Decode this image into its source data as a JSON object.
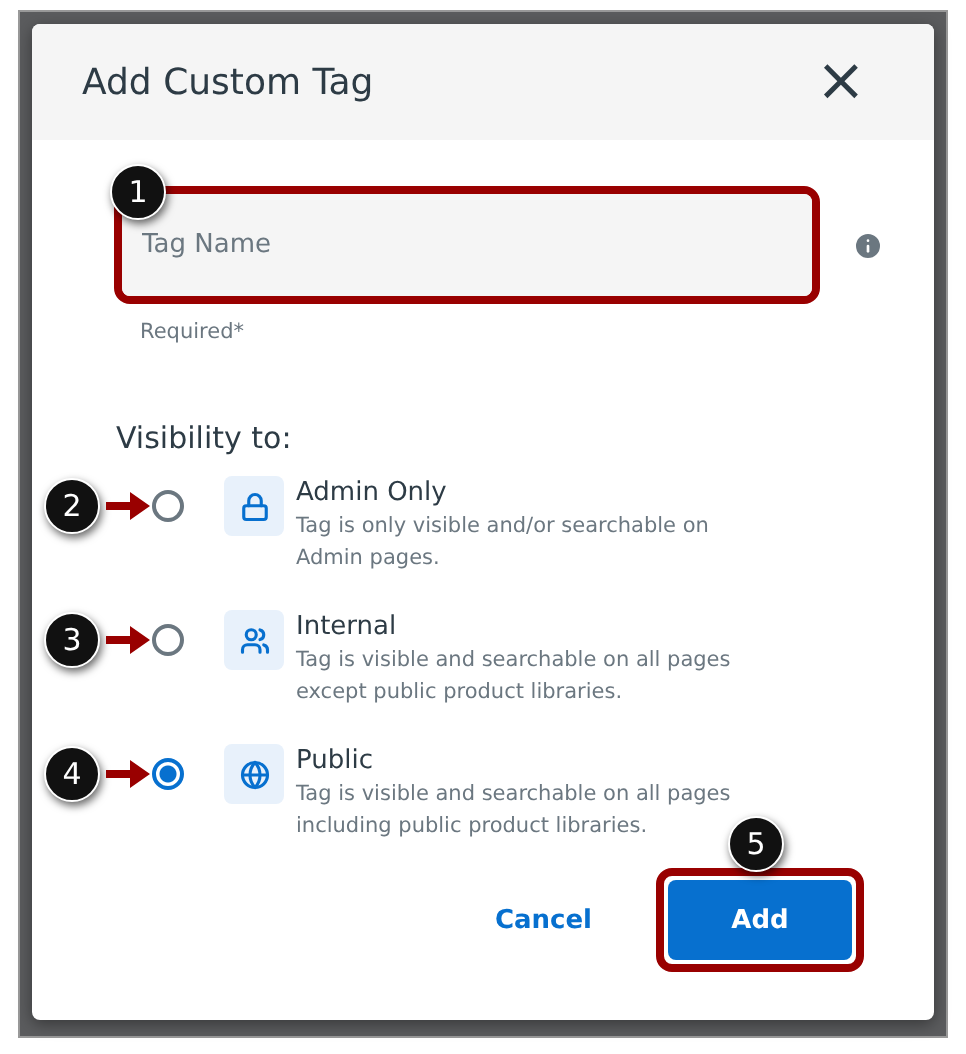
{
  "dialog": {
    "title": "Add Custom Tag",
    "close": "×"
  },
  "field": {
    "placeholder": "Tag Name",
    "hint": "Required*",
    "callout": "1"
  },
  "visibility": {
    "label": "Visibility to:",
    "options": [
      {
        "title": "Admin Only",
        "description": "Tag is only visible and/or searchable on Admin pages.",
        "selected": false,
        "callout": "2"
      },
      {
        "title": "Internal",
        "description": "Tag is visible and searchable on all pages except public product libraries.",
        "selected": false,
        "callout": "3"
      },
      {
        "title": "Public",
        "description": "Tag is visible and searchable on all pages including public product libraries.",
        "selected": true,
        "callout": "4"
      }
    ]
  },
  "buttons": {
    "cancel": "Cancel",
    "add": "Add",
    "callout": "5"
  }
}
